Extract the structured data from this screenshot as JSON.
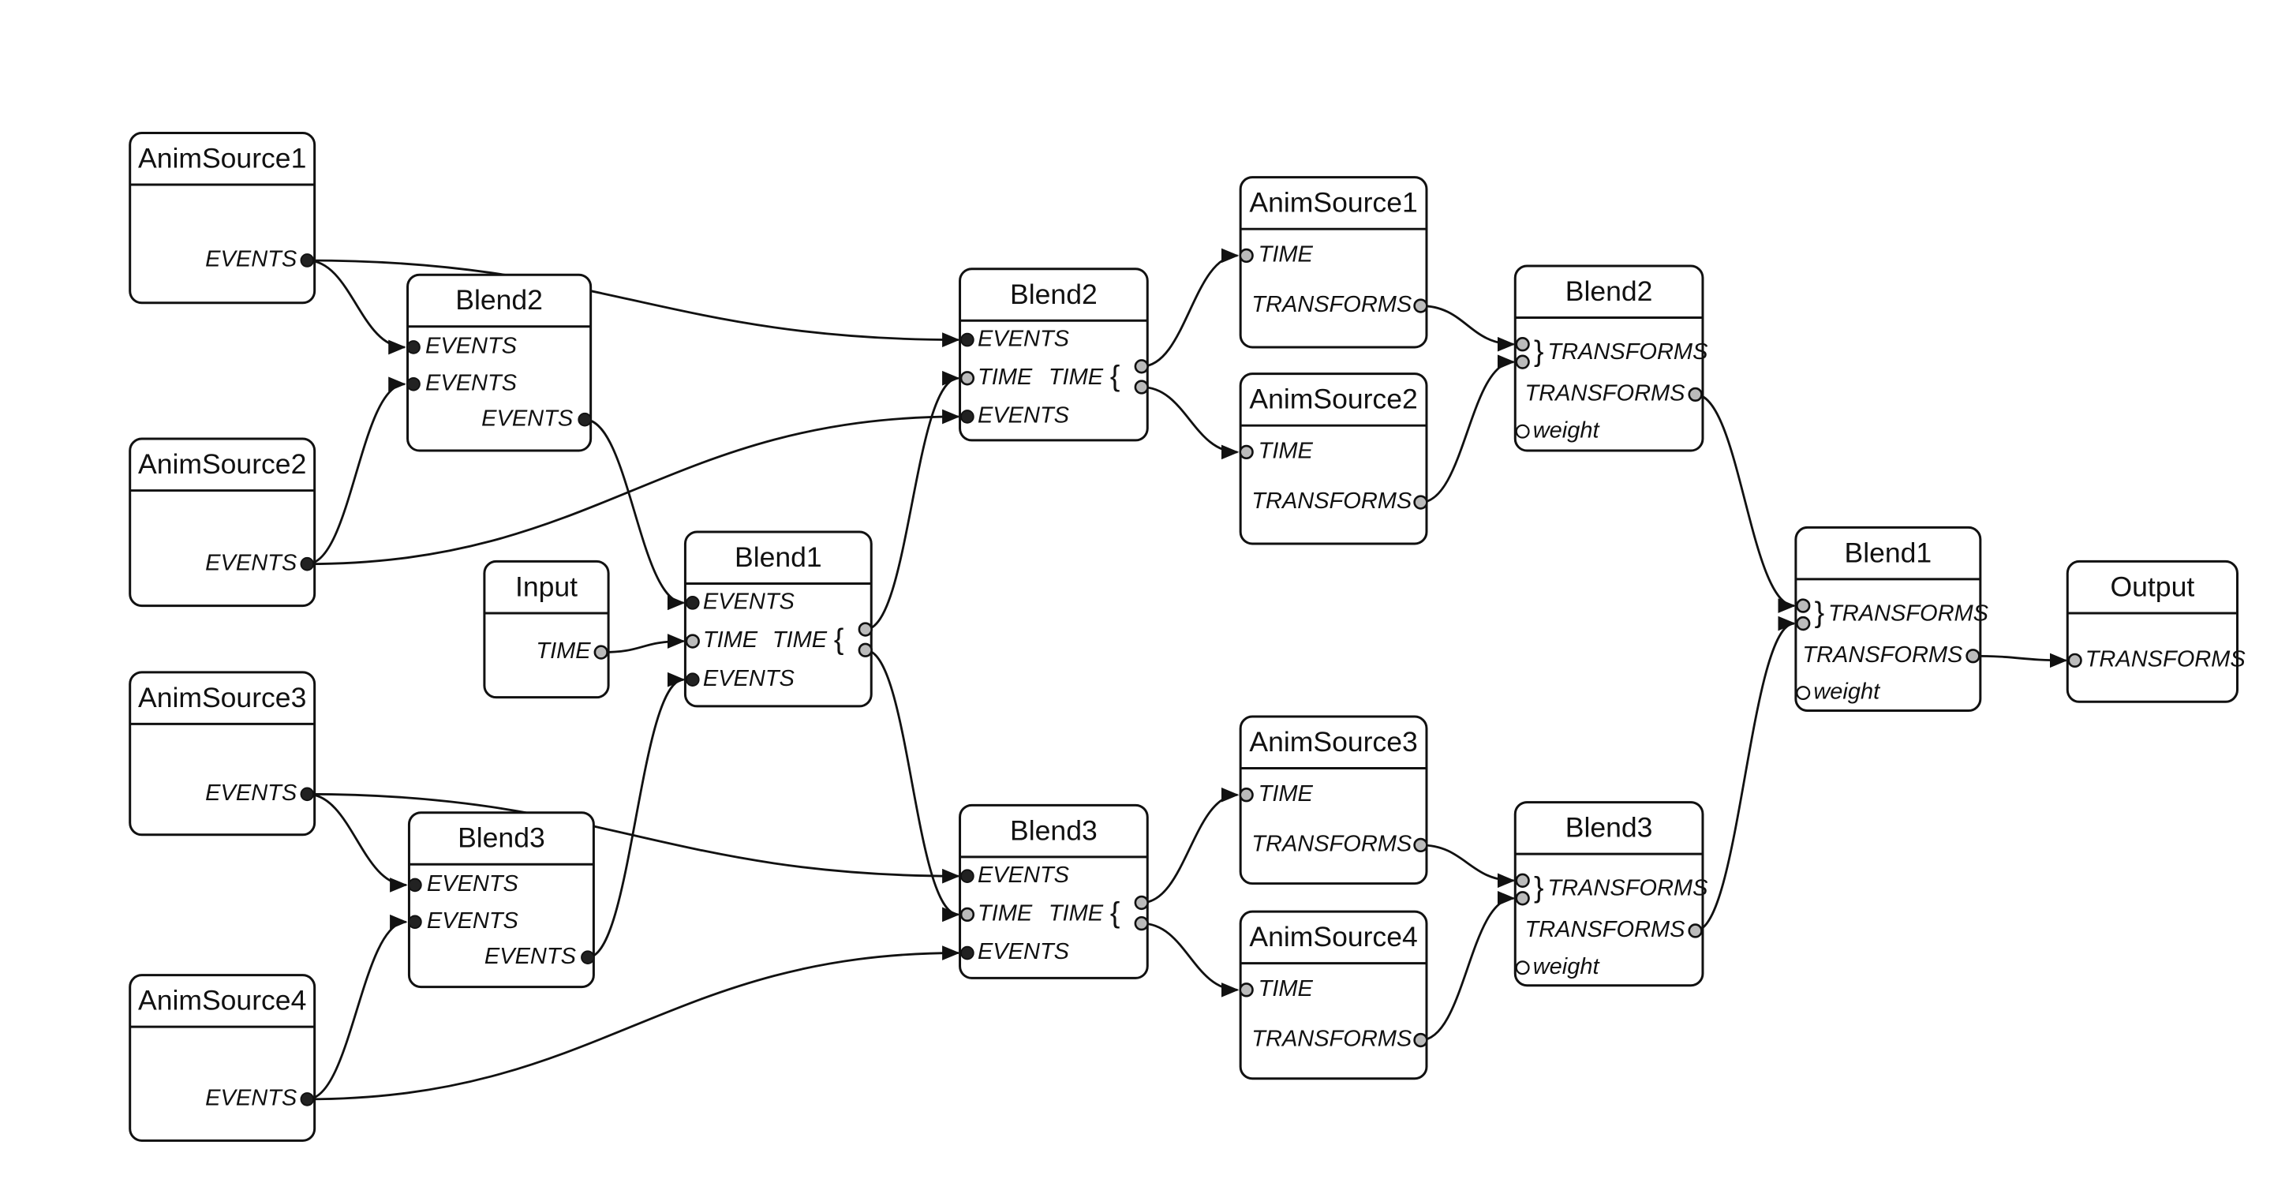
{
  "diagram": {
    "type": "animation-blend-graph",
    "nodes": [
      {
        "id": "as1_l",
        "title": "AnimSource1",
        "inputs": [],
        "outputs": [
          {
            "label": "EVENTS",
            "kind": "events"
          }
        ]
      },
      {
        "id": "as2_l",
        "title": "AnimSource2",
        "inputs": [],
        "outputs": [
          {
            "label": "EVENTS",
            "kind": "events"
          }
        ]
      },
      {
        "id": "as3_l",
        "title": "AnimSource3",
        "inputs": [],
        "outputs": [
          {
            "label": "EVENTS",
            "kind": "events"
          }
        ]
      },
      {
        "id": "as4_l",
        "title": "AnimSource4",
        "inputs": [],
        "outputs": [
          {
            "label": "EVENTS",
            "kind": "events"
          }
        ]
      },
      {
        "id": "b2_l",
        "title": "Blend2",
        "inputs": [
          {
            "label": "EVENTS",
            "kind": "events"
          },
          {
            "label": "EVENTS",
            "kind": "events"
          }
        ],
        "outputs": [
          {
            "label": "EVENTS",
            "kind": "events"
          }
        ]
      },
      {
        "id": "b3_l",
        "title": "Blend3",
        "inputs": [
          {
            "label": "EVENTS",
            "kind": "events"
          },
          {
            "label": "EVENTS",
            "kind": "events"
          }
        ],
        "outputs": [
          {
            "label": "EVENTS",
            "kind": "events"
          }
        ]
      },
      {
        "id": "input",
        "title": "Input",
        "inputs": [],
        "outputs": [
          {
            "label": "TIME",
            "kind": "data"
          }
        ]
      },
      {
        "id": "b1_l",
        "title": "Blend1",
        "inputs": [
          {
            "label": "EVENTS",
            "kind": "events"
          },
          {
            "label": "TIME",
            "kind": "data"
          },
          {
            "label": "EVENTS",
            "kind": "events"
          }
        ],
        "outputs": [
          {
            "label": "TIME",
            "kind": "data",
            "multi": 2
          }
        ]
      },
      {
        "id": "b2_m",
        "title": "Blend2",
        "inputs": [
          {
            "label": "EVENTS",
            "kind": "events"
          },
          {
            "label": "TIME",
            "kind": "data"
          },
          {
            "label": "EVENTS",
            "kind": "events"
          }
        ],
        "outputs": [
          {
            "label": "TIME",
            "kind": "data",
            "multi": 2
          }
        ]
      },
      {
        "id": "b3_m",
        "title": "Blend3",
        "inputs": [
          {
            "label": "EVENTS",
            "kind": "events"
          },
          {
            "label": "TIME",
            "kind": "data"
          },
          {
            "label": "EVENTS",
            "kind": "events"
          }
        ],
        "outputs": [
          {
            "label": "TIME",
            "kind": "data",
            "multi": 2
          }
        ]
      },
      {
        "id": "as1_r",
        "title": "AnimSource1",
        "inputs": [
          {
            "label": "TIME",
            "kind": "data"
          }
        ],
        "outputs": [
          {
            "label": "TRANSFORMS",
            "kind": "data"
          }
        ]
      },
      {
        "id": "as2_r",
        "title": "AnimSource2",
        "inputs": [
          {
            "label": "TIME",
            "kind": "data"
          }
        ],
        "outputs": [
          {
            "label": "TRANSFORMS",
            "kind": "data"
          }
        ]
      },
      {
        "id": "as3_r",
        "title": "AnimSource3",
        "inputs": [
          {
            "label": "TIME",
            "kind": "data"
          }
        ],
        "outputs": [
          {
            "label": "TRANSFORMS",
            "kind": "data"
          }
        ]
      },
      {
        "id": "as4_r",
        "title": "AnimSource4",
        "inputs": [
          {
            "label": "TIME",
            "kind": "data"
          }
        ],
        "outputs": [
          {
            "label": "TRANSFORMS",
            "kind": "data"
          }
        ]
      },
      {
        "id": "b2_r",
        "title": "Blend2",
        "inputs": [
          {
            "label": "TRANSFORMS",
            "kind": "data",
            "multi": 2
          },
          {
            "label": "weight",
            "kind": "weight"
          }
        ],
        "outputs": [
          {
            "label": "TRANSFORMS",
            "kind": "data"
          }
        ]
      },
      {
        "id": "b3_r",
        "title": "Blend3",
        "inputs": [
          {
            "label": "TRANSFORMS",
            "kind": "data",
            "multi": 2
          },
          {
            "label": "weight",
            "kind": "weight"
          }
        ],
        "outputs": [
          {
            "label": "TRANSFORMS",
            "kind": "data"
          }
        ]
      },
      {
        "id": "b1_r",
        "title": "Blend1",
        "inputs": [
          {
            "label": "TRANSFORMS",
            "kind": "data",
            "multi": 2
          },
          {
            "label": "weight",
            "kind": "weight"
          }
        ],
        "outputs": [
          {
            "label": "TRANSFORMS",
            "kind": "data"
          }
        ]
      },
      {
        "id": "output",
        "title": "Output",
        "inputs": [
          {
            "label": "TRANSFORMS",
            "kind": "data"
          }
        ],
        "outputs": []
      }
    ],
    "edges": [
      {
        "from": "as1_l.EVENTS",
        "to": "b2_l.EVENTS#1"
      },
      {
        "from": "as1_l.EVENTS",
        "to": "b2_m.EVENTS#1"
      },
      {
        "from": "as2_l.EVENTS",
        "to": "b2_l.EVENTS#2"
      },
      {
        "from": "as2_l.EVENTS",
        "to": "b2_m.EVENTS#2"
      },
      {
        "from": "b2_l.EVENTS",
        "to": "b1_l.EVENTS#1"
      },
      {
        "from": "input.TIME",
        "to": "b1_l.TIME"
      },
      {
        "from": "b3_l.EVENTS",
        "to": "b1_l.EVENTS#2"
      },
      {
        "from": "as3_l.EVENTS",
        "to": "b3_l.EVENTS#1"
      },
      {
        "from": "as3_l.EVENTS",
        "to": "b3_m.EVENTS#1"
      },
      {
        "from": "as4_l.EVENTS",
        "to": "b3_l.EVENTS#2"
      },
      {
        "from": "as4_l.EVENTS",
        "to": "b3_m.EVENTS#2"
      },
      {
        "from": "b1_l.TIME#1",
        "to": "b2_m.TIME"
      },
      {
        "from": "b1_l.TIME#2",
        "to": "b3_m.TIME"
      },
      {
        "from": "b2_m.TIME#1",
        "to": "as1_r.TIME"
      },
      {
        "from": "b2_m.TIME#2",
        "to": "as2_r.TIME"
      },
      {
        "from": "b3_m.TIME#1",
        "to": "as3_r.TIME"
      },
      {
        "from": "b3_m.TIME#2",
        "to": "as4_r.TIME"
      },
      {
        "from": "as1_r.TRANSFORMS",
        "to": "b2_r.TRANSFORMS#1"
      },
      {
        "from": "as2_r.TRANSFORMS",
        "to": "b2_r.TRANSFORMS#2"
      },
      {
        "from": "as3_r.TRANSFORMS",
        "to": "b3_r.TRANSFORMS#1"
      },
      {
        "from": "as4_r.TRANSFORMS",
        "to": "b3_r.TRANSFORMS#2"
      },
      {
        "from": "b2_r.TRANSFORMS",
        "to": "b1_r.TRANSFORMS#1"
      },
      {
        "from": "b3_r.TRANSFORMS",
        "to": "b1_r.TRANSFORMS#2"
      },
      {
        "from": "b1_r.TRANSFORMS",
        "to": "output.TRANSFORMS"
      }
    ]
  },
  "labels": {
    "events": "EVENTS",
    "time": "TIME",
    "transforms": "TRANSFORMS",
    "weight": "weight",
    "brace_open": "{",
    "brace_close": "}"
  }
}
